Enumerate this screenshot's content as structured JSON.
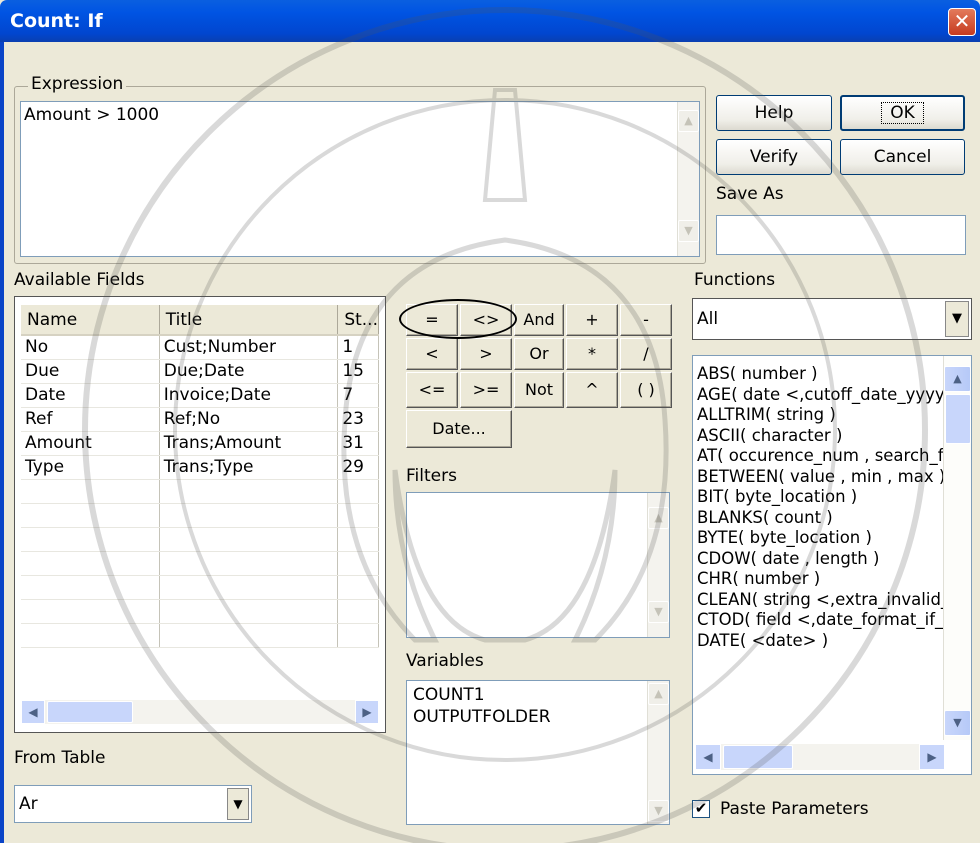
{
  "window": {
    "title": "Count: If",
    "close_glyph": "✕"
  },
  "expression": {
    "group_label": "Expression",
    "value": "Amount > 1000"
  },
  "buttons": {
    "help": "Help",
    "ok": "OK",
    "verify": "Verify",
    "cancel": "Cancel",
    "date": "Date..."
  },
  "save_as": {
    "label": "Save As",
    "value": ""
  },
  "available_fields": {
    "label": "Available Fields",
    "columns": [
      "Name",
      "Title",
      "St..."
    ],
    "rows": [
      [
        "No",
        "Cust;Number",
        "1"
      ],
      [
        "Due",
        "Due;Date",
        "15"
      ],
      [
        "Date",
        "Invoice;Date",
        "7"
      ],
      [
        "Ref",
        "Ref;No",
        "23"
      ],
      [
        "Amount",
        "Trans;Amount",
        "31"
      ],
      [
        "Type",
        "Trans;Type",
        "29"
      ]
    ]
  },
  "operators": [
    [
      "=",
      "<>",
      "And",
      "+",
      "-"
    ],
    [
      "<",
      ">",
      "Or",
      "*",
      "/"
    ],
    [
      "<=",
      ">=",
      "Not",
      "^",
      "( )"
    ]
  ],
  "filters": {
    "label": "Filters"
  },
  "variables": {
    "label": "Variables",
    "items": [
      "COUNT1",
      "OUTPUTFOLDER"
    ]
  },
  "from_table": {
    "label": "From Table",
    "value": "Ar"
  },
  "functions": {
    "label": "Functions",
    "category": "All",
    "items": [
      "ABS( number )",
      "AGE( date <,cutoff_date_yyyym",
      "ALLTRIM( string )",
      "ASCII( character )",
      "AT( occurence_num , search_fo",
      "BETWEEN( value , min , max )",
      "BIT( byte_location )",
      "BLANKS( count )",
      "BYTE( byte_location )",
      "CDOW( date , length )",
      "CHR( number )",
      "CLEAN( string <,extra_invalid_c",
      "CTOD( field <,date_format_if_nc",
      "DATE( <date> )"
    ]
  },
  "paste_parameters": {
    "label": "Paste Parameters",
    "checked": true
  },
  "colors": {
    "title_bar": "#0054e3",
    "dialog_bg": "#ece9d8"
  }
}
